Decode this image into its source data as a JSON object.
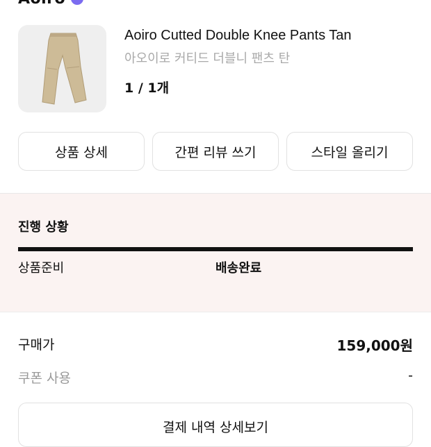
{
  "header": {
    "brand": "Aoiro"
  },
  "product": {
    "name_en": "Aoiro Cutted Double Knee Pants Tan",
    "name_ko": "아오이로 커티드 더블니 팬츠 탄",
    "quantity": "1 / 1개",
    "thumbnail_icon": "pants-image"
  },
  "actions": [
    {
      "label": "상품 상세"
    },
    {
      "label": "간편 리뷰 쓰기"
    },
    {
      "label": "스타일 올리기"
    }
  ],
  "progress": {
    "title": "진행 상황",
    "fraction_complete": 1.0,
    "stages": [
      "상품준비",
      "배송완료"
    ],
    "current_stage": "배송완료"
  },
  "payment": {
    "price_label": "구매가",
    "price_value": "159,000원",
    "coupon_label": "쿠폰 사용",
    "coupon_value": "-",
    "detail_button": "결제 내역 상세보기"
  },
  "colors": {
    "accent": "#7b6cf0",
    "progress_bg": "#fbf3f2"
  }
}
